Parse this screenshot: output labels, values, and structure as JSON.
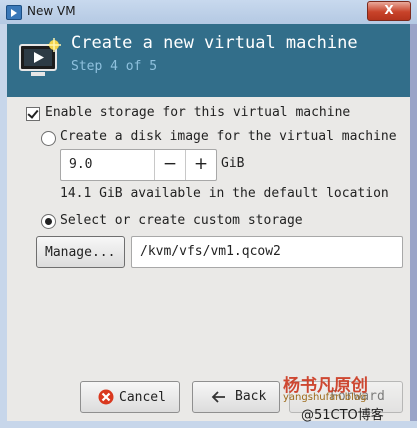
{
  "window": {
    "title": "New VM",
    "close_label": "X"
  },
  "header": {
    "title": "Create a new virtual machine",
    "step": "Step 4 of 5"
  },
  "storage": {
    "enable_label": "Enable storage for this virtual machine",
    "enable_checked": true,
    "create_disk_label": "Create a disk image for the virtual machine",
    "disk_size": "9.0",
    "disk_unit": "GiB",
    "decrement_label": "−",
    "increment_label": "+",
    "available_text": "14.1 GiB available in the default location",
    "custom_label": "Select or create custom storage",
    "manage_label": "Manage...",
    "path_value": "/kvm/vfs/vm1.qcow2",
    "selected_option": "custom"
  },
  "buttons": {
    "cancel": "Cancel",
    "back": "Back",
    "forward": "Forward"
  },
  "watermark": {
    "line1": "杨书凡原创",
    "line2": "yangshufan.blog",
    "line3": "@51CTO博客"
  }
}
